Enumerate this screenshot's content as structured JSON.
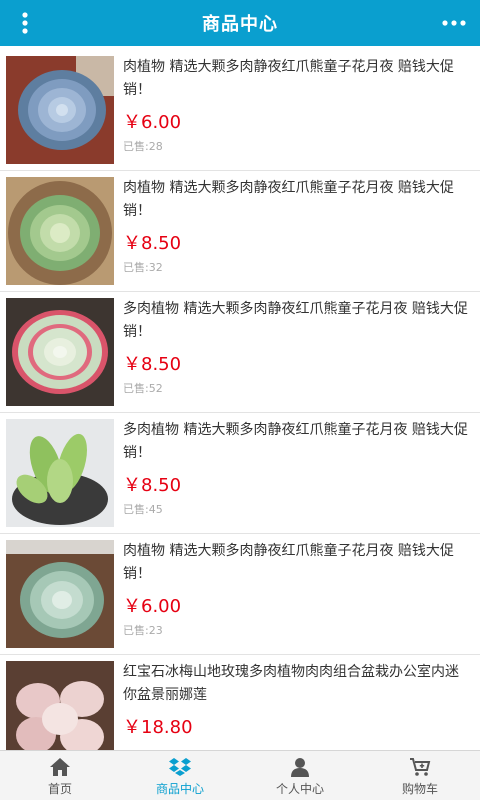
{
  "header": {
    "title": "商品中心"
  },
  "products": [
    {
      "name": "肉植物 精选大颗多肉静夜红爪熊童子花月夜 赔钱大促销！",
      "price": "￥6.00",
      "sold": "已售:28",
      "image": "succulent-blue-rosette"
    },
    {
      "name": "肉植物 精选大颗多肉静夜红爪熊童子花月夜 赔钱大促销！",
      "price": "￥8.50",
      "sold": "已售:32",
      "image": "succulent-green-rosette"
    },
    {
      "name": "多肉植物 精选大颗多肉静夜红爪熊童子花月夜 赔钱大促销！",
      "price": "￥8.50",
      "sold": "已售:52",
      "image": "succulent-red-edged-rosette"
    },
    {
      "name": "多肉植物 精选大颗多肉静夜红爪熊童子花月夜 赔钱大促销！",
      "price": "￥8.50",
      "sold": "已售:45",
      "image": "succulent-bear-paw"
    },
    {
      "name": "肉植物 精选大颗多肉静夜红爪熊童子花月夜 赔钱大促销！",
      "price": "￥6.00",
      "sold": "已售:23",
      "image": "succulent-mint-rosette"
    },
    {
      "name": "红宝石冰梅山地玫瑰多肉植物肉肉组合盆栽办公室内迷你盆景丽娜莲",
      "price": "￥18.80",
      "sold": "",
      "image": "succulent-pink-rosette"
    }
  ],
  "tabs": [
    {
      "label": "首页",
      "icon": "home-icon"
    },
    {
      "label": "商品中心",
      "icon": "dropbox-icon"
    },
    {
      "label": "个人中心",
      "icon": "user-icon"
    },
    {
      "label": "购物车",
      "icon": "cart-icon"
    }
  ],
  "colors": {
    "accent": "#0a9fcf",
    "price": "#e60012"
  }
}
